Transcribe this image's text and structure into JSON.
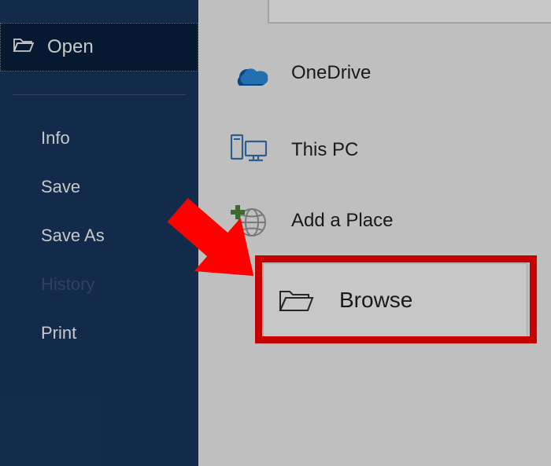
{
  "sidebar": {
    "selected_label": "Open",
    "items": [
      {
        "label": "Info"
      },
      {
        "label": "Save"
      },
      {
        "label": "Save As"
      },
      {
        "label": "History",
        "disabled": true
      },
      {
        "label": "Print"
      }
    ]
  },
  "locations": {
    "onedrive": "OneDrive",
    "this_pc": "This PC",
    "add_place": "Add a Place",
    "browse": "Browse"
  },
  "annotation": {
    "arrow_color": "#ff0000",
    "highlight": "browse"
  }
}
